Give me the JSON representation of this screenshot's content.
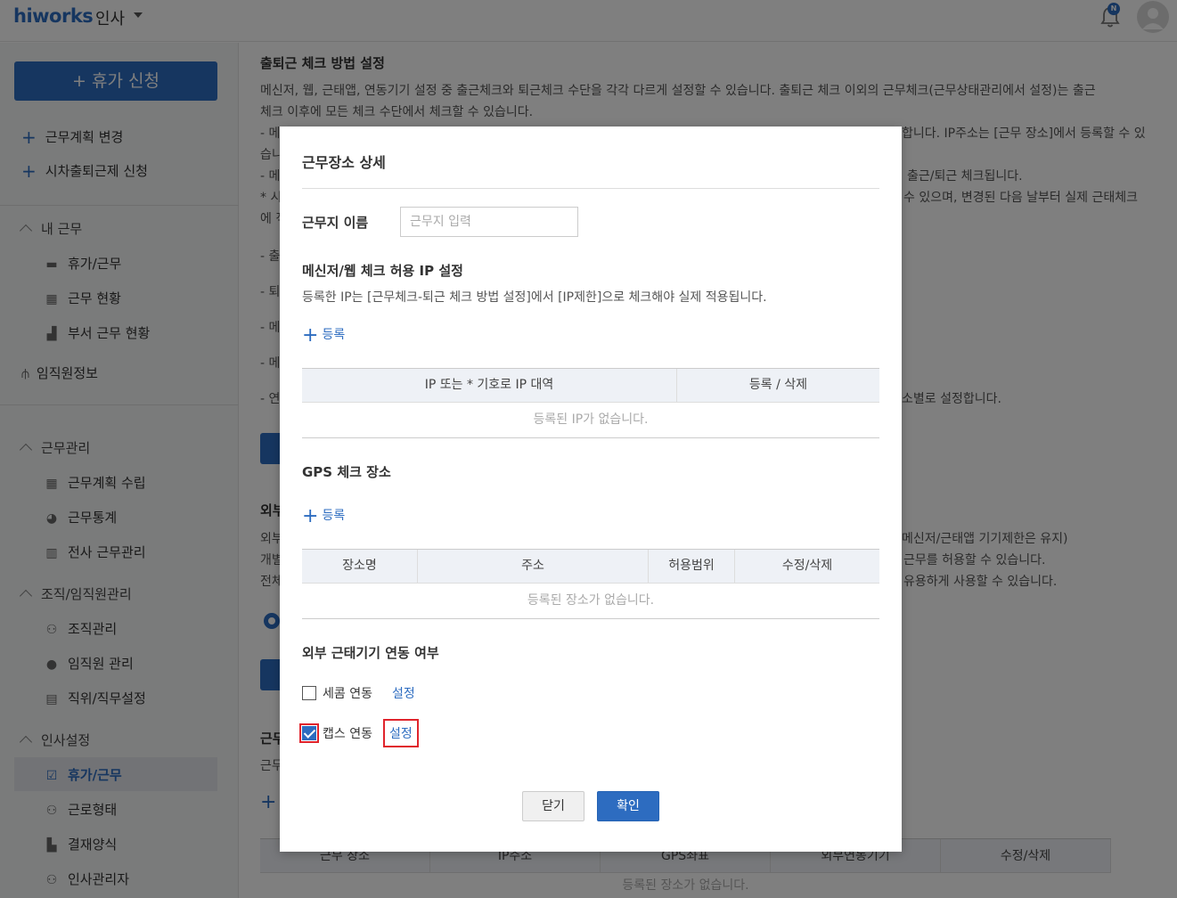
{
  "header": {
    "logo": "hiworks",
    "app": "인사",
    "bell_badge": "N"
  },
  "sidebar": {
    "vacation_button": "+ 휴가 신청",
    "plus_items": [
      "근무계획 변경",
      "시차출퇴근제 신청"
    ],
    "my_work": {
      "title": "내 근무",
      "items": [
        "휴가/근무",
        "근무 현황",
        "부서 근무 현황"
      ]
    },
    "employee_info": "임직원정보",
    "work_manage": {
      "title": "근무관리",
      "items": [
        "근무계획 수립",
        "근무통계",
        "전사 근무관리"
      ]
    },
    "org_manage": {
      "title": "조직/임직원관리",
      "items": [
        "조직관리",
        "임직원 관리",
        "직위/직무설정"
      ]
    },
    "hr_settings": {
      "title": "인사설정",
      "items": [
        "휴가/근무",
        "근로형태",
        "결재양식",
        "인사관리자"
      ]
    }
  },
  "background": {
    "heading": "출퇴근 체크 방법 설정",
    "line1": "메신저, 웹, 근태앱, 연동기기 설정 중 출근체크와 퇴근체크 수단을 각각 다르게 설정할 수 있습니다. 출퇴근 체크 이외의 근무체크(근무상태관리에서 설정)는 출근",
    "line2": "체크 이후에 모든 체크 수단에서 체크할 수 있습니다.",
    "line3_left": "- 메",
    "line3_right": "합니다. IP주소는 [근무 장소]에서 등록할 수 있",
    "line4_left": "습니",
    "line5_left": "- 메",
    "line5_right": "출근/퇴근 체크됩니다.",
    "line6_left": "* 시",
    "line6_right": "수 있으며, 변경된 다음 날부터 실제 근태체크",
    "line7_left": "에 적",
    "frag_a": "- 출",
    "frag_b": "- 퇴",
    "frag_c": "- 메",
    "frag_d": "- 메",
    "frag_e": "- 연",
    "frag_e_right": "소별로 설정합니다.",
    "ext_heading_frag": "외부",
    "ext1_left": "외부",
    "ext1_right": "메신저/근태앱 기기제한은 유지)",
    "ext2_left": "개별",
    "ext2_right": "근무를 허용할 수 있습니다.",
    "ext3_left": "전체",
    "ext3_right": "유용하게 사용할 수 있습니다.",
    "place_heading_frag": "근무",
    "place_desc_frag": "근무",
    "table_headers": [
      "근무 장소",
      "IP주소",
      "GPS좌표",
      "외부연동기기",
      "수정/삭제"
    ],
    "table_empty": "등록된 장소가 없습니다."
  },
  "modal": {
    "title": "근무장소 상세",
    "name_label": "근무지 이름",
    "name_placeholder": "근무지 입력",
    "ip_section": "메신저/웹 체크 허용 IP 설정",
    "ip_desc": "등록한 IP는 [근무체크-퇴근 체크 방법 설정]에서 [IP제한]으로 체크해야 실제 적용됩니다.",
    "add_label": "등록",
    "ip_table_headers": [
      "IP 또는 * 기호로 IP 대역",
      "등록 / 삭제"
    ],
    "ip_empty": "등록된 IP가 없습니다.",
    "gps_section": "GPS 체크 장소",
    "gps_table_headers": [
      "장소명",
      "주소",
      "허용범위",
      "수정/삭제"
    ],
    "gps_empty": "등록된 장소가 없습니다.",
    "ext_section": "외부 근태기기 연동 여부",
    "secom_label": "세콤 연동",
    "caps_label": "캡스 연동",
    "setting_label": "설정",
    "close_button": "닫기",
    "ok_button": "확인"
  }
}
